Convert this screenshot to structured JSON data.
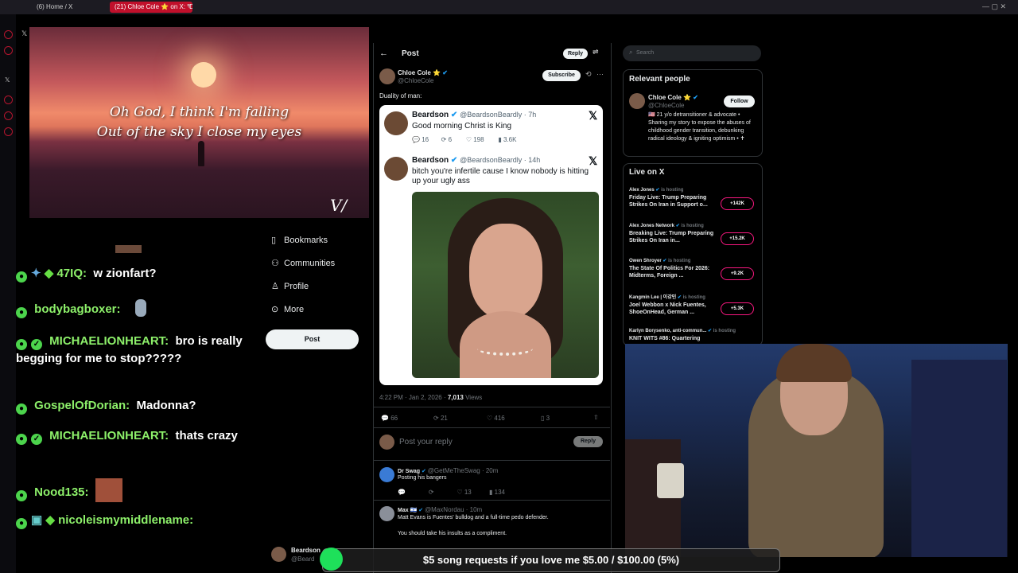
{
  "browser": {
    "tabs": [
      {
        "label": "(6) Home / X"
      },
      {
        "label": "(21) Chloe Cole ⭐ on X: \"D"
      }
    ],
    "new_tab": "+"
  },
  "video": {
    "lyric_line1": "Oh God, I think I'm falling",
    "lyric_line2": "Out of the sky I close my eyes"
  },
  "chat": [
    {
      "name": "47IQ:",
      "text": "w zionfart?"
    },
    {
      "name": "bodybagboxer:",
      "text": ""
    },
    {
      "name": "MICHAELIONHEART:",
      "text": "bro is really begging for me to stop?????"
    },
    {
      "name": "GospelOfDorian:",
      "text": "Madonna?"
    },
    {
      "name": "MICHAELIONHEART:",
      "text": "thats crazy"
    },
    {
      "name": "Nood135:",
      "text": ""
    },
    {
      "name": "nicoleismymiddlename:",
      "text": ""
    }
  ],
  "nav": {
    "items": [
      {
        "label": "Bookmarks",
        "icon": "bookmark-icon"
      },
      {
        "label": "Communities",
        "icon": "communities-icon"
      },
      {
        "label": "Profile",
        "icon": "profile-icon"
      },
      {
        "label": "More",
        "icon": "more-icon"
      }
    ],
    "post_button": "Post",
    "account_name": "Beardson",
    "account_handle": "@Beard"
  },
  "post": {
    "header": "Post",
    "reply_button": "Reply",
    "author_name": "Chloe Cole ⭐",
    "author_handle": "@ChloeCole",
    "subscribe": "Subscribe",
    "text": "Duality of man:",
    "quote1": {
      "name": "Beardson",
      "handle": "@BeardsonBeardly · 7h",
      "text": "Good morning Christ is King",
      "replies": "16",
      "reposts": "6",
      "likes": "198",
      "views": "3.6K"
    },
    "quote2": {
      "name": "Beardson",
      "handle": "@BeardsonBeardly · 14h",
      "text": "bitch you're infertile cause I know nobody is hitting up your ugly ass"
    },
    "timestamp": "4:22 PM · Jan 2, 2026 ·",
    "views_count": "7,013",
    "views_label": "Views",
    "stats": {
      "replies": "66",
      "reposts": "21",
      "likes": "416",
      "bookmarks": "3"
    },
    "reply_placeholder": "Post your reply",
    "reply_btn": "Reply"
  },
  "replies": [
    {
      "name": "Dr Swag",
      "handle": "@GetMeTheSwag · 20m",
      "text": "Posting his bangers",
      "likes": "13",
      "views": "134"
    },
    {
      "name": "Max 🇮🇱",
      "handle": "@MaxNordau · 10m",
      "text": "Matt Evans is Fuentes' bulldog and a full-time pedo defender.",
      "text2": "You should take his insults as a compliment."
    }
  ],
  "sidebar": {
    "search_placeholder": "Search",
    "relevant_title": "Relevant people",
    "person_name": "Chloe Cole ⭐",
    "person_handle": "@ChloeCole",
    "follow": "Follow",
    "bio": "🇺🇸 21 y/o detransitioner & advocate • Sharing my story to expose the abuses of childhood gender transition, debunking radical ideology & igniting optimism • ✝",
    "live_title": "Live on X",
    "live": [
      {
        "host": "Alex Jones",
        "status": "is hosting",
        "title": "Friday Live: Trump Preparing Strikes On Iran in Support o...",
        "count": "+142K"
      },
      {
        "host": "Alex Jones Network",
        "status": "is hosting",
        "title": "Breaking Live: Trump Preparing Strikes On Iran in...",
        "count": "+15.2K"
      },
      {
        "host": "Owen Shroyer",
        "status": "is hosting",
        "title": "The State Of Politics For 2026: Midterms, Foreign ...",
        "count": "+9.2K"
      },
      {
        "host": "Kangmin Lee | 이강민",
        "status": "is hosting",
        "title": "Joel Webbon x Nick Fuentes, ShoeOnHead, German ...",
        "count": "+5.3K"
      },
      {
        "host": "Karlyn Borysenko, anti-commun...",
        "status": "is hosting",
        "title": "KNIT WITS #86: Quartering",
        "count": ""
      }
    ]
  },
  "donation_bar": "$5 song requests if you love me $5.00 / $100.00 (5%)"
}
